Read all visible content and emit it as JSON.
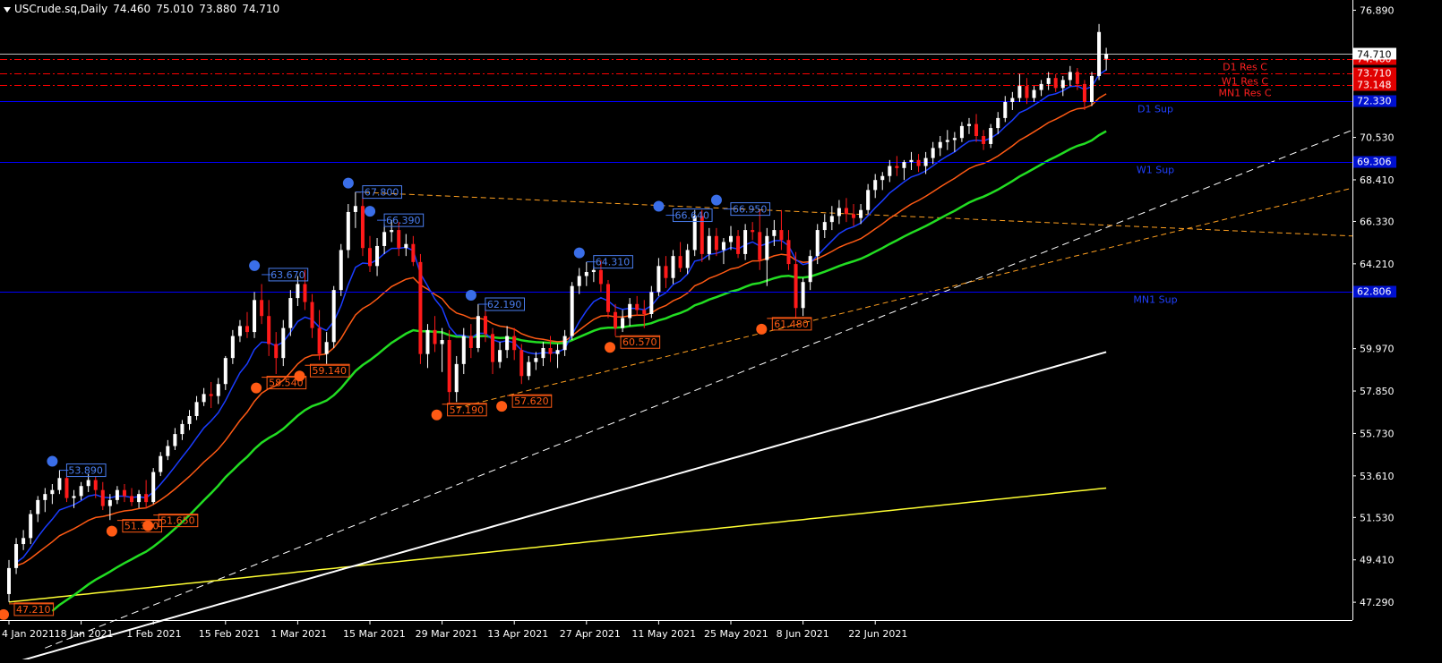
{
  "window": {
    "symbol": "USCrude.sq,Daily",
    "ohlc": [
      "74.460",
      "75.010",
      "73.880",
      "74.710"
    ]
  },
  "chart_data": {
    "type": "candlestick",
    "symbol": "USCrude.sq",
    "timeframe": "Daily",
    "ylim": [
      46.4,
      77.4
    ],
    "price_ticks": [
      "76.890",
      "70.530",
      "68.410",
      "66.330",
      "64.210",
      "59.970",
      "57.850",
      "55.730",
      "53.610",
      "51.530",
      "49.410",
      "47.290"
    ],
    "date_labels": [
      "4 Jan 2021",
      "18 Jan 2021",
      "1 Feb 2021",
      "15 Feb 2021",
      "1 Mar 2021",
      "15 Mar 2021",
      "29 Mar 2021",
      "13 Apr 2021",
      "27 Apr 2021",
      "11 May 2021",
      "25 May 2021",
      "8 Jun 2021",
      "22 Jun 2021"
    ],
    "date_label_bar_index": [
      0,
      10,
      20,
      30,
      40,
      50,
      60,
      70,
      80,
      90,
      100,
      110,
      120
    ],
    "candles": [
      [
        47.7,
        49.4,
        47.3,
        49.0
      ],
      [
        49.0,
        50.5,
        48.7,
        50.2
      ],
      [
        50.2,
        50.9,
        49.9,
        50.5
      ],
      [
        50.5,
        51.9,
        50.2,
        51.7
      ],
      [
        51.7,
        52.6,
        51.3,
        52.4
      ],
      [
        52.4,
        53.0,
        51.8,
        52.7
      ],
      [
        52.7,
        53.2,
        52.2,
        52.9
      ],
      [
        52.9,
        53.9,
        52.7,
        53.5
      ],
      [
        53.5,
        53.8,
        52.3,
        52.5
      ],
      [
        52.5,
        52.9,
        52.0,
        52.6
      ],
      [
        52.6,
        53.3,
        52.4,
        53.1
      ],
      [
        53.1,
        53.7,
        52.8,
        53.4
      ],
      [
        53.4,
        53.6,
        52.5,
        52.9
      ],
      [
        52.9,
        53.3,
        51.9,
        52.1
      ],
      [
        52.1,
        52.7,
        51.4,
        52.4
      ],
      [
        52.4,
        53.1,
        52.2,
        52.9
      ],
      [
        52.9,
        53.2,
        52.3,
        52.6
      ],
      [
        52.6,
        53.0,
        52.1,
        52.3
      ],
      [
        52.3,
        52.9,
        52.0,
        52.7
      ],
      [
        52.7,
        53.4,
        52.0,
        52.3
      ],
      [
        52.3,
        54.0,
        52.2,
        53.8
      ],
      [
        53.8,
        54.8,
        53.6,
        54.6
      ],
      [
        54.6,
        55.4,
        54.4,
        55.1
      ],
      [
        55.1,
        56.0,
        54.9,
        55.7
      ],
      [
        55.7,
        56.4,
        55.4,
        56.2
      ],
      [
        56.2,
        56.9,
        55.9,
        56.6
      ],
      [
        56.6,
        57.6,
        56.4,
        57.3
      ],
      [
        57.3,
        58.0,
        57.1,
        57.7
      ],
      [
        57.7,
        58.3,
        57.0,
        57.6
      ],
      [
        57.6,
        58.5,
        57.2,
        58.2
      ],
      [
        58.2,
        59.6,
        57.9,
        59.5
      ],
      [
        59.5,
        60.9,
        59.2,
        60.6
      ],
      [
        60.6,
        61.4,
        60.3,
        61.1
      ],
      [
        61.1,
        61.8,
        60.5,
        60.8
      ],
      [
        60.8,
        62.8,
        60.5,
        62.4
      ],
      [
        62.4,
        63.2,
        61.2,
        61.6
      ],
      [
        61.6,
        62.4,
        59.6,
        60.2
      ],
      [
        60.2,
        60.8,
        58.7,
        59.5
      ],
      [
        59.5,
        61.4,
        59.1,
        61.0
      ],
      [
        61.0,
        62.9,
        60.6,
        62.5
      ],
      [
        62.5,
        63.6,
        62.1,
        63.2
      ],
      [
        63.2,
        63.9,
        61.9,
        62.3
      ],
      [
        62.3,
        62.7,
        60.5,
        61.0
      ],
      [
        61.0,
        61.9,
        59.4,
        59.7
      ],
      [
        59.7,
        60.8,
        59.2,
        60.3
      ],
      [
        60.3,
        63.1,
        60.0,
        62.9
      ],
      [
        62.9,
        65.2,
        62.6,
        64.9
      ],
      [
        64.9,
        67.2,
        64.5,
        66.8
      ],
      [
        66.8,
        67.8,
        66.0,
        67.1
      ],
      [
        67.1,
        67.8,
        64.6,
        65.0
      ],
      [
        65.0,
        65.6,
        63.8,
        64.1
      ],
      [
        64.1,
        65.5,
        63.6,
        65.1
      ],
      [
        65.1,
        66.2,
        64.7,
        65.8
      ],
      [
        65.8,
        66.4,
        65.3,
        65.9
      ],
      [
        65.9,
        66.3,
        64.6,
        65.0
      ],
      [
        65.0,
        65.7,
        64.6,
        65.2
      ],
      [
        65.2,
        65.6,
        64.1,
        64.3
      ],
      [
        64.3,
        64.7,
        59.2,
        59.7
      ],
      [
        59.7,
        61.2,
        59.0,
        60.9
      ],
      [
        60.9,
        61.6,
        59.8,
        60.2
      ],
      [
        60.2,
        61.0,
        58.8,
        60.4
      ],
      [
        60.4,
        60.9,
        57.2,
        57.8
      ],
      [
        57.8,
        59.6,
        57.3,
        59.2
      ],
      [
        59.2,
        61.0,
        58.7,
        60.6
      ],
      [
        60.6,
        61.2,
        59.5,
        60.0
      ],
      [
        60.0,
        62.2,
        59.8,
        61.6
      ],
      [
        61.6,
        62.1,
        60.3,
        60.7
      ],
      [
        60.7,
        61.0,
        58.7,
        59.3
      ],
      [
        59.3,
        60.3,
        59.0,
        59.9
      ],
      [
        59.9,
        61.1,
        59.5,
        60.6
      ],
      [
        60.6,
        61.0,
        59.4,
        59.9
      ],
      [
        59.9,
        60.2,
        58.2,
        58.6
      ],
      [
        58.6,
        59.6,
        58.4,
        59.3
      ],
      [
        59.3,
        59.8,
        58.9,
        59.5
      ],
      [
        59.5,
        60.3,
        59.1,
        60.0
      ],
      [
        60.0,
        60.6,
        59.3,
        59.7
      ],
      [
        59.7,
        60.2,
        59.0,
        59.9
      ],
      [
        59.9,
        60.9,
        59.6,
        60.6
      ],
      [
        60.6,
        63.3,
        60.4,
        63.1
      ],
      [
        63.1,
        64.0,
        62.7,
        63.6
      ],
      [
        63.6,
        64.3,
        63.1,
        63.8
      ],
      [
        63.8,
        64.1,
        63.3,
        63.9
      ],
      [
        63.9,
        64.4,
        62.8,
        63.2
      ],
      [
        63.2,
        63.4,
        61.5,
        61.8
      ],
      [
        61.8,
        62.2,
        60.6,
        61.0
      ],
      [
        61.0,
        61.9,
        60.8,
        61.5
      ],
      [
        61.5,
        62.5,
        61.1,
        62.2
      ],
      [
        62.2,
        62.6,
        61.6,
        61.9
      ],
      [
        61.9,
        62.4,
        61.0,
        61.7
      ],
      [
        61.7,
        63.1,
        61.5,
        62.8
      ],
      [
        62.8,
        64.5,
        62.6,
        64.1
      ],
      [
        64.1,
        64.6,
        63.0,
        63.5
      ],
      [
        63.5,
        64.9,
        63.2,
        64.6
      ],
      [
        64.6,
        65.3,
        63.8,
        64.0
      ],
      [
        64.0,
        65.2,
        63.7,
        64.9
      ],
      [
        64.9,
        66.9,
        64.6,
        66.6
      ],
      [
        66.6,
        66.9,
        64.3,
        64.7
      ],
      [
        64.7,
        66.0,
        64.4,
        65.6
      ],
      [
        65.6,
        66.0,
        64.6,
        64.9
      ],
      [
        64.9,
        65.5,
        64.2,
        65.3
      ],
      [
        65.3,
        66.1,
        64.9,
        65.6
      ],
      [
        65.6,
        65.9,
        64.5,
        64.7
      ],
      [
        64.7,
        66.2,
        64.4,
        65.9
      ],
      [
        65.9,
        66.3,
        65.4,
        65.8
      ],
      [
        65.8,
        66.9,
        63.9,
        64.4
      ],
      [
        64.4,
        66.0,
        63.1,
        65.6
      ],
      [
        65.6,
        66.4,
        65.1,
        65.9
      ],
      [
        65.9,
        66.9,
        64.9,
        65.4
      ],
      [
        65.4,
        65.9,
        63.9,
        64.2
      ],
      [
        64.2,
        64.8,
        61.5,
        62.0
      ],
      [
        62.0,
        63.5,
        61.6,
        63.3
      ],
      [
        63.3,
        64.9,
        62.9,
        64.6
      ],
      [
        64.6,
        66.2,
        64.2,
        65.9
      ],
      [
        65.9,
        66.7,
        65.5,
        66.3
      ],
      [
        66.3,
        67.1,
        65.9,
        66.6
      ],
      [
        66.6,
        67.4,
        66.2,
        67.0
      ],
      [
        67.0,
        67.5,
        66.3,
        66.7
      ],
      [
        66.7,
        67.2,
        66.1,
        66.5
      ],
      [
        66.5,
        67.2,
        66.2,
        66.9
      ],
      [
        66.9,
        68.2,
        66.7,
        67.9
      ],
      [
        67.9,
        68.7,
        67.5,
        68.4
      ],
      [
        68.4,
        68.8,
        67.9,
        68.6
      ],
      [
        68.6,
        69.4,
        68.3,
        69.1
      ],
      [
        69.1,
        69.6,
        68.6,
        69.0
      ],
      [
        69.0,
        69.4,
        68.4,
        69.3
      ],
      [
        69.3,
        69.8,
        68.9,
        69.4
      ],
      [
        69.4,
        69.7,
        68.8,
        69.1
      ],
      [
        69.1,
        69.8,
        68.7,
        69.5
      ],
      [
        69.5,
        70.3,
        69.2,
        70.0
      ],
      [
        70.0,
        70.6,
        69.6,
        70.3
      ],
      [
        70.3,
        70.9,
        69.9,
        70.4
      ],
      [
        70.4,
        70.8,
        69.8,
        70.5
      ],
      [
        70.5,
        71.3,
        70.3,
        71.1
      ],
      [
        71.1,
        71.5,
        70.7,
        71.2
      ],
      [
        71.2,
        71.7,
        70.3,
        70.6
      ],
      [
        70.6,
        70.9,
        69.9,
        70.2
      ],
      [
        70.2,
        71.2,
        70.0,
        71.0
      ],
      [
        71.0,
        71.8,
        70.7,
        71.5
      ],
      [
        71.5,
        72.6,
        71.3,
        72.3
      ],
      [
        72.3,
        72.8,
        71.9,
        72.5
      ],
      [
        72.5,
        73.7,
        72.3,
        73.1
      ],
      [
        73.1,
        73.5,
        72.2,
        72.5
      ],
      [
        72.5,
        73.1,
        72.3,
        72.9
      ],
      [
        72.9,
        73.4,
        72.6,
        73.2
      ],
      [
        73.2,
        73.8,
        72.9,
        73.5
      ],
      [
        73.5,
        73.7,
        72.8,
        73.0
      ],
      [
        73.0,
        73.6,
        72.6,
        73.4
      ],
      [
        73.4,
        74.1,
        73.1,
        73.8
      ],
      [
        73.8,
        74.0,
        72.9,
        73.2
      ],
      [
        73.2,
        73.4,
        71.9,
        72.3
      ],
      [
        72.3,
        73.8,
        72.1,
        73.6
      ],
      [
        73.6,
        76.2,
        73.4,
        75.8
      ],
      [
        74.46,
        75.01,
        73.88,
        74.71
      ]
    ],
    "horizontal_levels": [
      {
        "name": "D1 Res C",
        "value": "74.460",
        "color": "#ff0000",
        "style": "dashdot",
        "label_side": "D1 Res C"
      },
      {
        "name": "W1 Res C",
        "value": "73.710",
        "color": "#ff0000",
        "style": "dashdot",
        "label_side": "W1 Res C"
      },
      {
        "name": "MN1 Res C",
        "value": "73.148",
        "color": "#ff0000",
        "style": "dashdot",
        "label_side": "MN1 Res C"
      },
      {
        "name": "D1 Sup",
        "value": "72.330",
        "color": "#0000ff",
        "style": "solid",
        "label_side": "D1 Sup"
      },
      {
        "name": "W1 Sup",
        "value": "69.306",
        "color": "#0000ff",
        "style": "solid",
        "label_side": "W1 Sup"
      },
      {
        "name": "MN1 Sup",
        "value": "62.806",
        "color": "#0000ff",
        "style": "solid",
        "label_side": "MN1 Sup"
      }
    ],
    "current_price_tag": "74.710",
    "swing_highs": [
      {
        "bar": 7,
        "price": 53.89,
        "label": "53.890"
      },
      {
        "bar": 35,
        "price": 63.67,
        "label": "63.670"
      },
      {
        "bar": 48,
        "price": 67.8,
        "label": "67.800"
      },
      {
        "bar": 51,
        "price": 66.39,
        "label": "66.390"
      },
      {
        "bar": 65,
        "price": 62.19,
        "label": "62.190"
      },
      {
        "bar": 80,
        "price": 64.31,
        "label": "64.310"
      },
      {
        "bar": 91,
        "price": 66.64,
        "label": "66.640"
      },
      {
        "bar": 99,
        "price": 66.95,
        "label": "66.950"
      }
    ],
    "swing_lows": [
      {
        "bar": 0,
        "price": 47.21,
        "label": "47.210"
      },
      {
        "bar": 15,
        "price": 51.38,
        "label": "51.380"
      },
      {
        "bar": 20,
        "price": 51.65,
        "label": "51.650"
      },
      {
        "bar": 35,
        "price": 58.54,
        "label": "58.540"
      },
      {
        "bar": 41,
        "price": 59.14,
        "label": "59.140"
      },
      {
        "bar": 60,
        "price": 57.19,
        "label": "57.190"
      },
      {
        "bar": 69,
        "price": 57.62,
        "label": "57.620"
      },
      {
        "bar": 84,
        "price": 60.57,
        "label": "60.570"
      },
      {
        "bar": 105,
        "price": 61.48,
        "label": "61.480"
      }
    ]
  }
}
